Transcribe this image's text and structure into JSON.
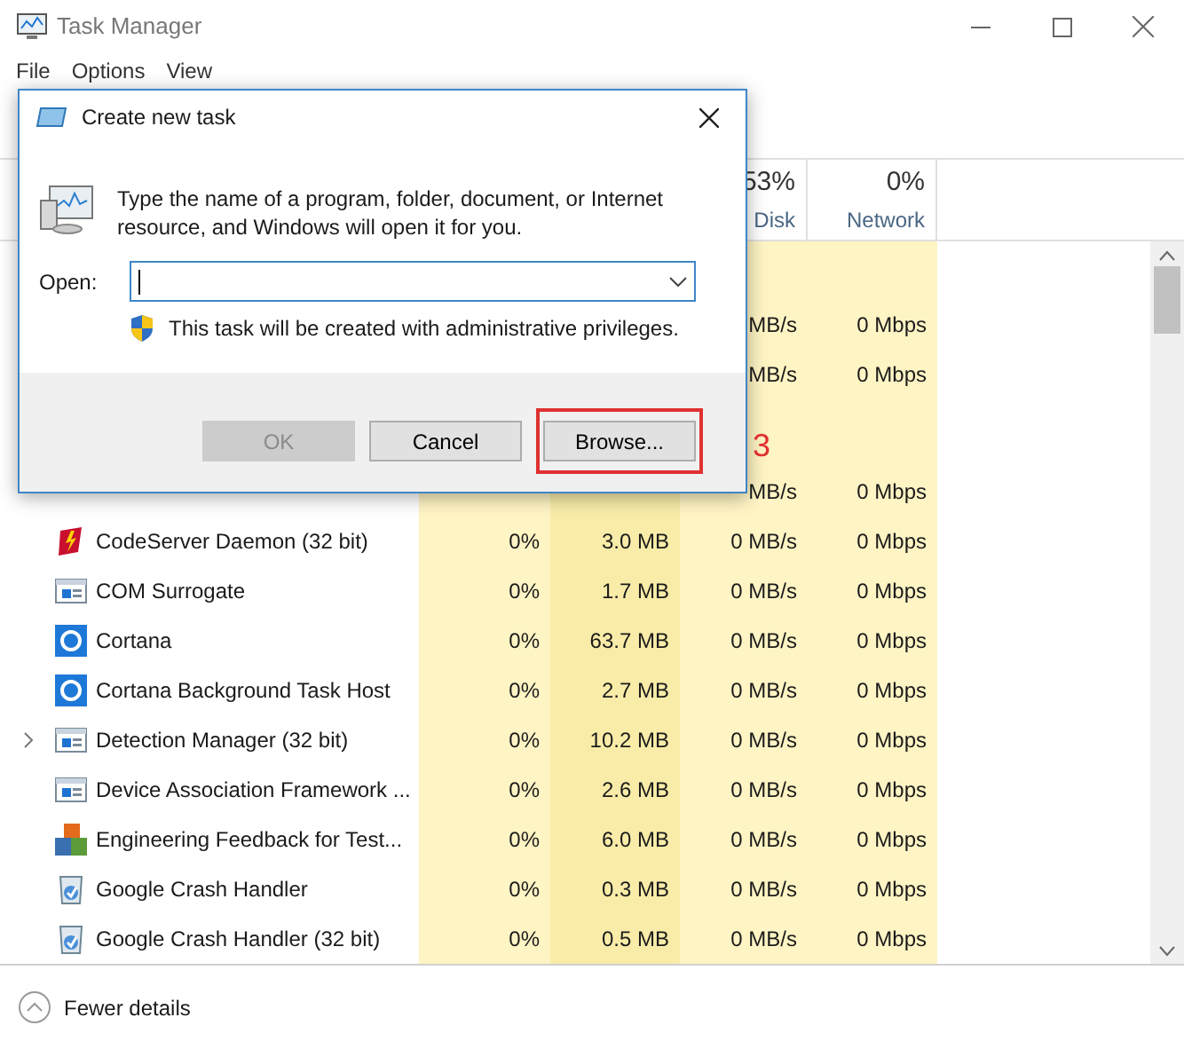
{
  "window": {
    "title": "Task Manager"
  },
  "menu": [
    "File",
    "Options",
    "View"
  ],
  "columns": [
    {
      "percent": "53%",
      "label": "Disk"
    },
    {
      "percent": "0%",
      "label": "Network"
    }
  ],
  "partial_rows": [
    {
      "disk": "MB/s",
      "network": "0 Mbps"
    },
    {
      "disk": "MB/s",
      "network": "0 Mbps"
    },
    {
      "disk": "MB/s",
      "network": "0 Mbps"
    }
  ],
  "rows": [
    {
      "kind": "flame",
      "name": "CodeServer Daemon (32 bit)",
      "expandable": false,
      "cpu": "0%",
      "memory": "3.0 MB",
      "disk": "0 MB/s",
      "network": "0 Mbps"
    },
    {
      "kind": "window",
      "name": "COM Surrogate",
      "expandable": false,
      "cpu": "0%",
      "memory": "1.7 MB",
      "disk": "0 MB/s",
      "network": "0 Mbps"
    },
    {
      "kind": "ring",
      "name": "Cortana",
      "expandable": false,
      "cpu": "0%",
      "memory": "63.7 MB",
      "disk": "0 MB/s",
      "network": "0 Mbps"
    },
    {
      "kind": "ring",
      "name": "Cortana Background Task Host",
      "expandable": false,
      "cpu": "0%",
      "memory": "2.7 MB",
      "disk": "0 MB/s",
      "network": "0 Mbps"
    },
    {
      "kind": "window",
      "name": "Detection Manager (32 bit)",
      "expandable": true,
      "cpu": "0%",
      "memory": "10.2 MB",
      "disk": "0 MB/s",
      "network": "0 Mbps"
    },
    {
      "kind": "window",
      "name": "Device Association Framework ...",
      "expandable": false,
      "cpu": "0%",
      "memory": "2.6 MB",
      "disk": "0 MB/s",
      "network": "0 Mbps"
    },
    {
      "kind": "blocks",
      "name": "Engineering Feedback for Test...",
      "expandable": false,
      "cpu": "0%",
      "memory": "6.0 MB",
      "disk": "0 MB/s",
      "network": "0 Mbps"
    },
    {
      "kind": "crash",
      "name": "Google Crash Handler",
      "expandable": false,
      "cpu": "0%",
      "memory": "0.3 MB",
      "disk": "0 MB/s",
      "network": "0 Mbps"
    },
    {
      "kind": "crash",
      "name": "Google Crash Handler (32 bit)",
      "expandable": false,
      "cpu": "0%",
      "memory": "0.5 MB",
      "disk": "0 MB/s",
      "network": "0 Mbps"
    }
  ],
  "footer": {
    "label": "Fewer details"
  },
  "dialog": {
    "title": "Create new task",
    "message": "Type the name of a program, folder, document, or Internet resource, and Windows will open it for you.",
    "open_label": "Open:",
    "admin_note": "This task will be created with administrative privileges.",
    "buttons": [
      {
        "label": "OK",
        "disabled": true,
        "highlighted": false
      },
      {
        "label": "Cancel",
        "disabled": false,
        "highlighted": false
      },
      {
        "label": "Browse...",
        "disabled": false,
        "highlighted": true
      }
    ],
    "step_number": "3"
  }
}
